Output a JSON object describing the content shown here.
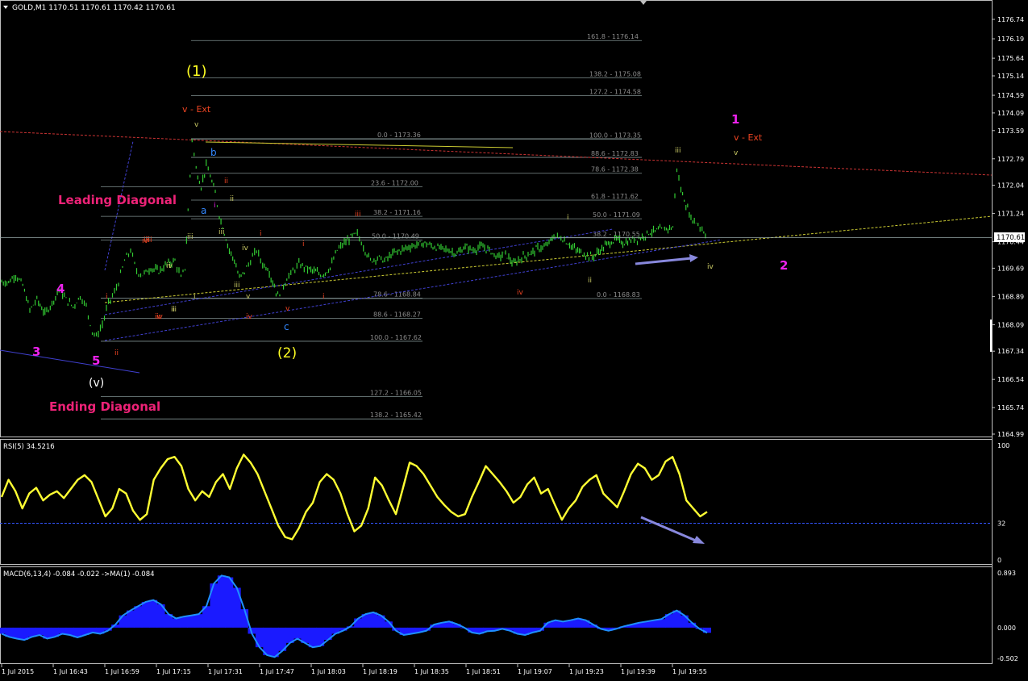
{
  "window": {
    "header": "GOLD,M1  1170.51 1170.61 1170.42 1170.61",
    "current_price_label": "1170.61"
  },
  "colors": {
    "background": "#000000",
    "frame": "#bfbfbf",
    "candle": "#33cc33",
    "rsi_line": "#ffff33",
    "macd_hist": "#1a1aff",
    "macd_signal": "#1e90ff",
    "fib_line": "#7f8f8f",
    "fib_text": "#8c8c8c",
    "trend_blue": "#4040d0",
    "trend_yellow": "#cccc33",
    "trend_red": "#cc3333",
    "magenta": "#ee22ee",
    "pink": "#ee2277",
    "wave_yellow": "#ffff22",
    "wave_red": "#ee4422",
    "wave_olive": "#cccc66",
    "wave_blue": "#3388ff",
    "arrow": "#8888dd"
  },
  "chart_data": [
    {
      "type": "candlestick",
      "symbol": "GOLD",
      "timeframe": "M1",
      "ohlc_header": {
        "open": 1170.51,
        "high": 1170.61,
        "low": 1170.42,
        "close": 1170.61
      },
      "current_price": 1170.61,
      "ylim": [
        1164.99,
        1176.74
      ],
      "yticks": [
        1176.74,
        1176.19,
        1175.64,
        1175.14,
        1174.59,
        1174.09,
        1173.59,
        1172.79,
        1172.04,
        1171.24,
        1170.44,
        1169.69,
        1168.89,
        1168.09,
        1167.34,
        1166.54,
        1165.74,
        1164.99
      ],
      "x_labels": [
        "1 Jul 2015",
        "1 Jul 16:43",
        "1 Jul 16:59",
        "1 Jul 17:15",
        "1 Jul 17:31",
        "1 Jul 17:47",
        "1 Jul 18:03",
        "1 Jul 18:19",
        "1 Jul 18:35",
        "1 Jul 18:51",
        "1 Jul 19:07",
        "1 Jul 19:23",
        "1 Jul 19:39",
        "1 Jul 19:55"
      ],
      "price_path": [
        [
          0,
          1169.3
        ],
        [
          0.7,
          1169.3
        ],
        [
          1.4,
          1169.5
        ],
        [
          2.1,
          1169.2
        ],
        [
          2.8,
          1168.5
        ],
        [
          3.5,
          1168.8
        ],
        [
          4.3,
          1168.4
        ],
        [
          5.0,
          1168.7
        ],
        [
          5.7,
          1169.1
        ],
        [
          6.4,
          1168.8
        ],
        [
          7.1,
          1168.6
        ],
        [
          7.8,
          1168.9
        ],
        [
          8.4,
          1168.6
        ],
        [
          9.0,
          1167.9
        ],
        [
          9.4,
          1167.75
        ],
        [
          10.0,
          1168.1
        ],
        [
          10.6,
          1168.7
        ],
        [
          11.2,
          1169.0
        ],
        [
          11.6,
          1169.3
        ],
        [
          12.2,
          1169.9
        ],
        [
          12.8,
          1170.2
        ],
        [
          13.4,
          1169.6
        ],
        [
          14.0,
          1169.5
        ],
        [
          14.8,
          1169.7
        ],
        [
          15.6,
          1169.6
        ],
        [
          16.4,
          1169.8
        ],
        [
          17.2,
          1169.9
        ],
        [
          17.8,
          1169.4
        ],
        [
          18.2,
          1169.7
        ],
        [
          18.5,
          1171.3
        ],
        [
          18.9,
          1173.35
        ],
        [
          19.3,
          1172.5
        ],
        [
          19.8,
          1172.0
        ],
        [
          20.3,
          1172.6
        ],
        [
          20.7,
          1172.3
        ],
        [
          21.2,
          1171.8
        ],
        [
          21.6,
          1171.2
        ],
        [
          22.1,
          1170.7
        ],
        [
          22.6,
          1170.2
        ],
        [
          23.1,
          1169.9
        ],
        [
          23.6,
          1169.4
        ],
        [
          24.1,
          1169.6
        ],
        [
          24.7,
          1169.9
        ],
        [
          25.3,
          1170.2
        ],
        [
          25.9,
          1169.8
        ],
        [
          26.4,
          1169.7
        ],
        [
          26.9,
          1169.3
        ],
        [
          27.4,
          1168.9
        ],
        [
          27.8,
          1169.1
        ],
        [
          28.3,
          1169.4
        ],
        [
          28.9,
          1169.6
        ],
        [
          29.5,
          1169.8
        ],
        [
          30.2,
          1169.7
        ],
        [
          31.0,
          1169.6
        ],
        [
          31.8,
          1169.5
        ],
        [
          32.6,
          1169.7
        ],
        [
          33.3,
          1170.2
        ],
        [
          34.0,
          1170.4
        ],
        [
          34.8,
          1170.6
        ],
        [
          35.3,
          1170.65
        ],
        [
          35.9,
          1170.3
        ],
        [
          36.6,
          1169.9
        ],
        [
          37.3,
          1170.0
        ],
        [
          38.0,
          1169.9
        ],
        [
          38.8,
          1170.1
        ],
        [
          39.6,
          1170.2
        ],
        [
          40.4,
          1170.3
        ],
        [
          41.2,
          1170.35
        ],
        [
          42.0,
          1170.4
        ],
        [
          42.8,
          1170.3
        ],
        [
          43.6,
          1170.25
        ],
        [
          44.4,
          1170.2
        ],
        [
          45.2,
          1170.1
        ],
        [
          46.0,
          1170.3
        ],
        [
          46.8,
          1170.2
        ],
        [
          47.6,
          1170.3
        ],
        [
          48.4,
          1170.2
        ],
        [
          49.2,
          1170.0
        ],
        [
          50.0,
          1170.1
        ],
        [
          50.8,
          1169.8
        ],
        [
          51.6,
          1170.0
        ],
        [
          52.4,
          1170.1
        ],
        [
          53.2,
          1170.25
        ],
        [
          54.0,
          1170.3
        ],
        [
          54.8,
          1170.6
        ],
        [
          55.5,
          1170.55
        ],
        [
          56.2,
          1170.4
        ],
        [
          57.0,
          1170.2
        ],
        [
          57.8,
          1170.1
        ],
        [
          58.6,
          1170.0
        ],
        [
          59.4,
          1170.2
        ],
        [
          60.2,
          1170.4
        ],
        [
          61.0,
          1170.5
        ],
        [
          61.8,
          1170.4
        ],
        [
          62.6,
          1170.5
        ],
        [
          63.4,
          1170.55
        ],
        [
          64.2,
          1170.7
        ],
        [
          65.0,
          1170.75
        ],
        [
          65.8,
          1170.8
        ],
        [
          66.6,
          1170.85
        ],
        [
          67.0,
          1172.55
        ],
        [
          67.4,
          1171.9
        ],
        [
          67.9,
          1171.5
        ],
        [
          68.4,
          1171.1
        ],
        [
          68.9,
          1171.0
        ],
        [
          69.5,
          1170.8
        ],
        [
          70.0,
          1170.61
        ]
      ],
      "fibonacci": [
        {
          "label": "161.8 - 1176.14",
          "value": 1176.14
        },
        {
          "label": "138.2 - 1175.08",
          "value": 1175.08
        },
        {
          "label": "127.2 - 1174.58",
          "value": 1174.58
        },
        {
          "label": "0.0 - 1173.36",
          "value": 1173.36
        },
        {
          "label": "100.0 - 1173.35",
          "value": 1173.35
        },
        {
          "label": "88.6 - 1172.83",
          "value": 1172.83
        },
        {
          "label": "78.6 - 1172.38",
          "value": 1172.38
        },
        {
          "label": "23.6 - 1172.00",
          "value": 1172.0
        },
        {
          "label": "61.8 - 1171.62",
          "value": 1171.62
        },
        {
          "label": "38.2 - 1171.16",
          "value": 1171.16
        },
        {
          "label": "50.0 - 1171.09",
          "value": 1171.09
        },
        {
          "label": "50.0 - 1170.49",
          "value": 1170.49
        },
        {
          "label": "38.2 - 1170.55",
          "value": 1170.55
        },
        {
          "label": "78.6 - 1168.84",
          "value": 1168.84
        },
        {
          "label": "0.0 - 1168.83",
          "value": 1168.83
        },
        {
          "label": "88.6 - 1168.27",
          "value": 1168.27
        },
        {
          "label": "100.0 - 1167.62",
          "value": 1167.62
        },
        {
          "label": "127.2 - 1166.05",
          "value": 1166.05
        },
        {
          "label": "138.2 - 1165.42",
          "value": 1165.42
        }
      ],
      "annotations": [
        "(1)",
        "v - Ext",
        "v",
        "b",
        "ii",
        "Leading Diagonal",
        "a",
        "i",
        "ii",
        "iii",
        "iv",
        "iii",
        "iii",
        "i",
        "iv",
        "i",
        "iii",
        "iv",
        "iv",
        "i",
        "v",
        "i",
        "v",
        "iv",
        "ii",
        "i",
        "ii",
        "4",
        "iii",
        "iv",
        "ii",
        "3",
        "5",
        "(v)",
        "Ending Diagonal",
        "c",
        "(2)",
        "ii",
        "iv",
        "i",
        "1",
        "v - Ext",
        "v",
        "iii",
        "iv",
        "2",
        "iii",
        "i"
      ]
    },
    {
      "type": "line",
      "name": "RSI(5) 34.5216",
      "current_value": 34.5216,
      "ylim": [
        0,
        100
      ],
      "yticks": [
        100,
        32,
        0
      ],
      "level": 32,
      "values": [
        55,
        70,
        60,
        45,
        58,
        63,
        52,
        57,
        60,
        54,
        62,
        70,
        74,
        68,
        53,
        38,
        45,
        62,
        58,
        43,
        35,
        40,
        70,
        80,
        88,
        90,
        82,
        62,
        52,
        60,
        55,
        68,
        75,
        62,
        80,
        92,
        85,
        75,
        60,
        45,
        30,
        20,
        18,
        28,
        42,
        50,
        68,
        75,
        70,
        58,
        40,
        25,
        30,
        45,
        72,
        65,
        52,
        40,
        62,
        85,
        82,
        75,
        65,
        55,
        48,
        42,
        38,
        40,
        55,
        68,
        82,
        75,
        68,
        60,
        50,
        55,
        66,
        72,
        58,
        62,
        48,
        35,
        45,
        52,
        64,
        70,
        74,
        58,
        52,
        46,
        60,
        75,
        84,
        80,
        70,
        74,
        86,
        90,
        75,
        52,
        45,
        38,
        42
      ]
    },
    {
      "type": "histogram",
      "name": "MACD(6,13,4) -0.084 -0.022 ->MA(1) -0.084",
      "ylim": [
        -0.502,
        0.893
      ],
      "yticks": [
        0.893,
        0.0,
        -0.502
      ],
      "values": [
        -0.1,
        -0.15,
        -0.18,
        -0.2,
        -0.15,
        -0.12,
        -0.18,
        -0.15,
        -0.1,
        -0.12,
        -0.16,
        -0.12,
        -0.08,
        -0.1,
        -0.05,
        0.05,
        0.2,
        0.28,
        0.35,
        0.42,
        0.45,
        0.38,
        0.22,
        0.15,
        0.18,
        0.2,
        0.22,
        0.35,
        0.72,
        0.85,
        0.82,
        0.65,
        0.3,
        -0.1,
        -0.32,
        -0.45,
        -0.48,
        -0.38,
        -0.25,
        -0.18,
        -0.25,
        -0.32,
        -0.3,
        -0.2,
        -0.1,
        -0.05,
        0.02,
        0.15,
        0.22,
        0.25,
        0.2,
        0.1,
        -0.05,
        -0.12,
        -0.1,
        -0.08,
        -0.05,
        0.05,
        0.08,
        0.1,
        0.06,
        0.0,
        -0.08,
        -0.1,
        -0.06,
        -0.05,
        -0.02,
        -0.05,
        -0.1,
        -0.12,
        -0.08,
        -0.05,
        0.08,
        0.12,
        0.1,
        0.12,
        0.15,
        0.12,
        0.05,
        -0.02,
        -0.05,
        -0.02,
        0.02,
        0.05,
        0.08,
        0.1,
        0.12,
        0.14,
        0.22,
        0.28,
        0.2,
        0.08,
        -0.02,
        -0.084
      ]
    }
  ]
}
